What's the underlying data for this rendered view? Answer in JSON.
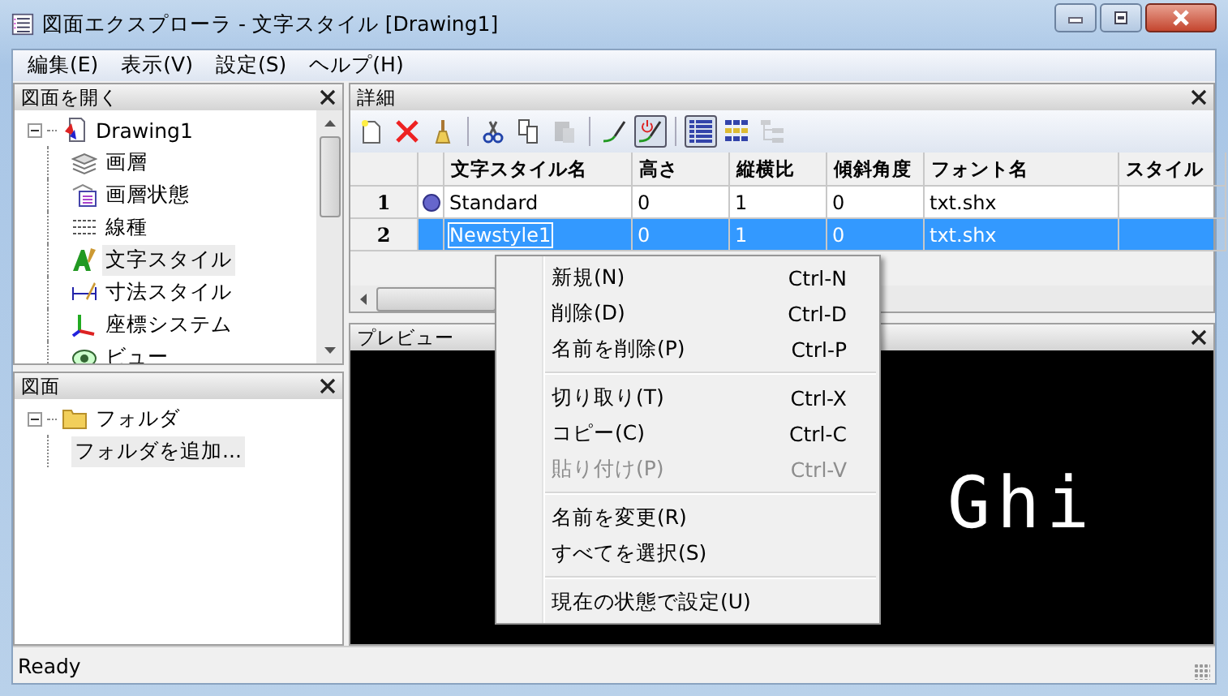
{
  "window": {
    "title": "図面エクスプローラ - 文字スタイル [Drawing1]"
  },
  "menu_bar": [
    "編集(E)",
    "表示(V)",
    "設定(S)",
    "ヘルプ(H)"
  ],
  "open_drawings_panel": {
    "title": "図面を開く",
    "tree": [
      {
        "label": "Drawing1",
        "kind": "drawing",
        "expanded": true,
        "selected": false,
        "children": [
          {
            "label": "画層",
            "kind": "layers",
            "selected": false
          },
          {
            "label": "画層状態",
            "kind": "layer-states",
            "selected": false
          },
          {
            "label": "線種",
            "kind": "linetypes",
            "selected": false
          },
          {
            "label": "文字スタイル",
            "kind": "text-style",
            "selected": true
          },
          {
            "label": "寸法スタイル",
            "kind": "dim-style",
            "selected": false
          },
          {
            "label": "座標システム",
            "kind": "ucs",
            "selected": false
          },
          {
            "label": "ビュー",
            "kind": "view",
            "selected": false
          }
        ]
      }
    ]
  },
  "drawings_panel": {
    "title": "図面",
    "tree": [
      {
        "label": "フォルダ",
        "kind": "folder",
        "expanded": true,
        "selected": false,
        "children": [
          {
            "label": "フォルダを追加...",
            "selected": true
          }
        ]
      }
    ]
  },
  "details_panel": {
    "title": "詳細",
    "toolbar": [
      {
        "kind": "new",
        "pressed": false,
        "disabled": false
      },
      {
        "kind": "delete",
        "pressed": false,
        "disabled": false
      },
      {
        "kind": "purge",
        "pressed": false,
        "disabled": false
      },
      {
        "kind": "separator"
      },
      {
        "kind": "cut",
        "pressed": false,
        "disabled": false
      },
      {
        "kind": "copy",
        "pressed": false,
        "disabled": false
      },
      {
        "kind": "paste",
        "pressed": false,
        "disabled": true
      },
      {
        "kind": "separator"
      },
      {
        "kind": "pen",
        "pressed": false,
        "disabled": false
      },
      {
        "kind": "pen-power",
        "pressed": true,
        "disabled": false
      },
      {
        "kind": "separator"
      },
      {
        "kind": "list-view",
        "pressed": true,
        "disabled": false
      },
      {
        "kind": "icon-view",
        "pressed": false,
        "disabled": false
      },
      {
        "kind": "tree-view",
        "pressed": false,
        "disabled": true
      }
    ],
    "table": {
      "columns": [
        "文字スタイル名",
        "高さ",
        "縦横比",
        "傾斜角度",
        "フォント名",
        "スタイル"
      ],
      "rows": [
        {
          "number": "1",
          "current": true,
          "selected": false,
          "cells": [
            "Standard",
            "0",
            "1",
            "0",
            "txt.shx",
            ""
          ]
        },
        {
          "number": "2",
          "current": false,
          "selected": true,
          "cells": [
            "Newstyle1",
            "0",
            "1",
            "0",
            "txt.shx",
            ""
          ]
        }
      ]
    }
  },
  "preview_panel": {
    "title": "プレビュー",
    "preview_text": "Ghi"
  },
  "context_menu": {
    "groups": [
      [
        {
          "label": "新規(N)",
          "shortcut": "Ctrl-N",
          "disabled": false
        },
        {
          "label": "削除(D)",
          "shortcut": "Ctrl-D",
          "disabled": false
        },
        {
          "label": "名前を削除(P)",
          "shortcut": "Ctrl-P",
          "disabled": false
        }
      ],
      [
        {
          "label": "切り取り(T)",
          "shortcut": "Ctrl-X",
          "disabled": false
        },
        {
          "label": "コピー(C)",
          "shortcut": "Ctrl-C",
          "disabled": false
        },
        {
          "label": "貼り付け(P)",
          "shortcut": "Ctrl-V",
          "disabled": true
        }
      ],
      [
        {
          "label": "名前を変更(R)",
          "disabled": false
        },
        {
          "label": "すべてを選択(S)",
          "disabled": false
        }
      ],
      [
        {
          "label": "現在の状態で設定(U)",
          "disabled": false
        }
      ]
    ]
  },
  "status_bar": {
    "text": "Ready"
  }
}
